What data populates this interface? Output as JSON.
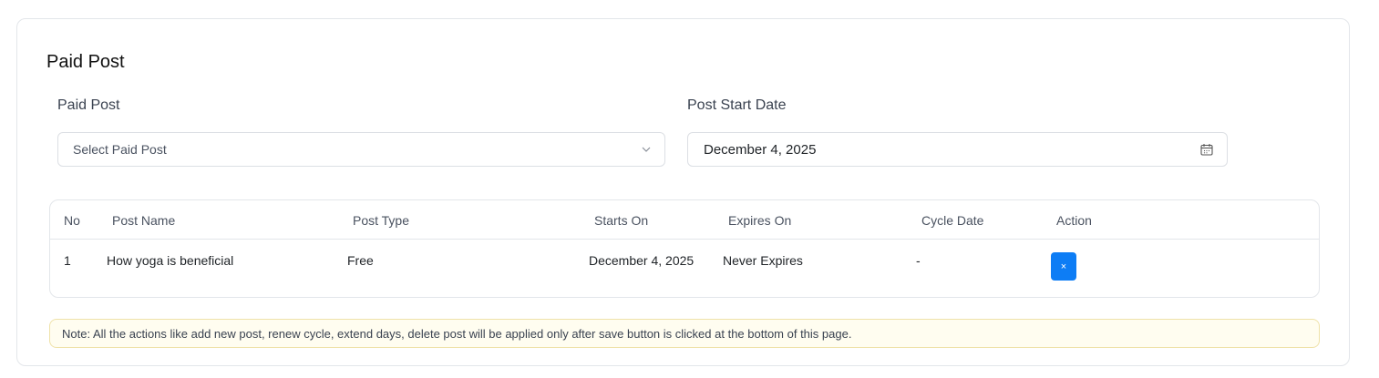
{
  "section": {
    "title": "Paid Post"
  },
  "form": {
    "paid_post_label": "Paid Post",
    "paid_post_placeholder": "Select Paid Post",
    "start_date_label": "Post Start Date",
    "start_date_value": "December 4, 2025"
  },
  "table": {
    "headers": [
      "No",
      "Post Name",
      "Post Type",
      "Starts On",
      "Expires On",
      "Cycle Date",
      "Action"
    ],
    "rows": [
      {
        "no": "1",
        "post_name": "How yoga is beneficial",
        "post_type": "Free",
        "starts_on": "December 4, 2025",
        "expires_on": "Never Expires",
        "cycle_date": "-",
        "action_icon": "close-icon",
        "action_glyph": "×"
      }
    ]
  },
  "note": "Note: All the actions like add new post, renew cycle, extend days, delete post will be applied only after save button is clicked at the bottom of this page.",
  "colors": {
    "primary": "#0d7df5",
    "note_bg": "#fffdf0",
    "note_border": "#efe2a8"
  }
}
